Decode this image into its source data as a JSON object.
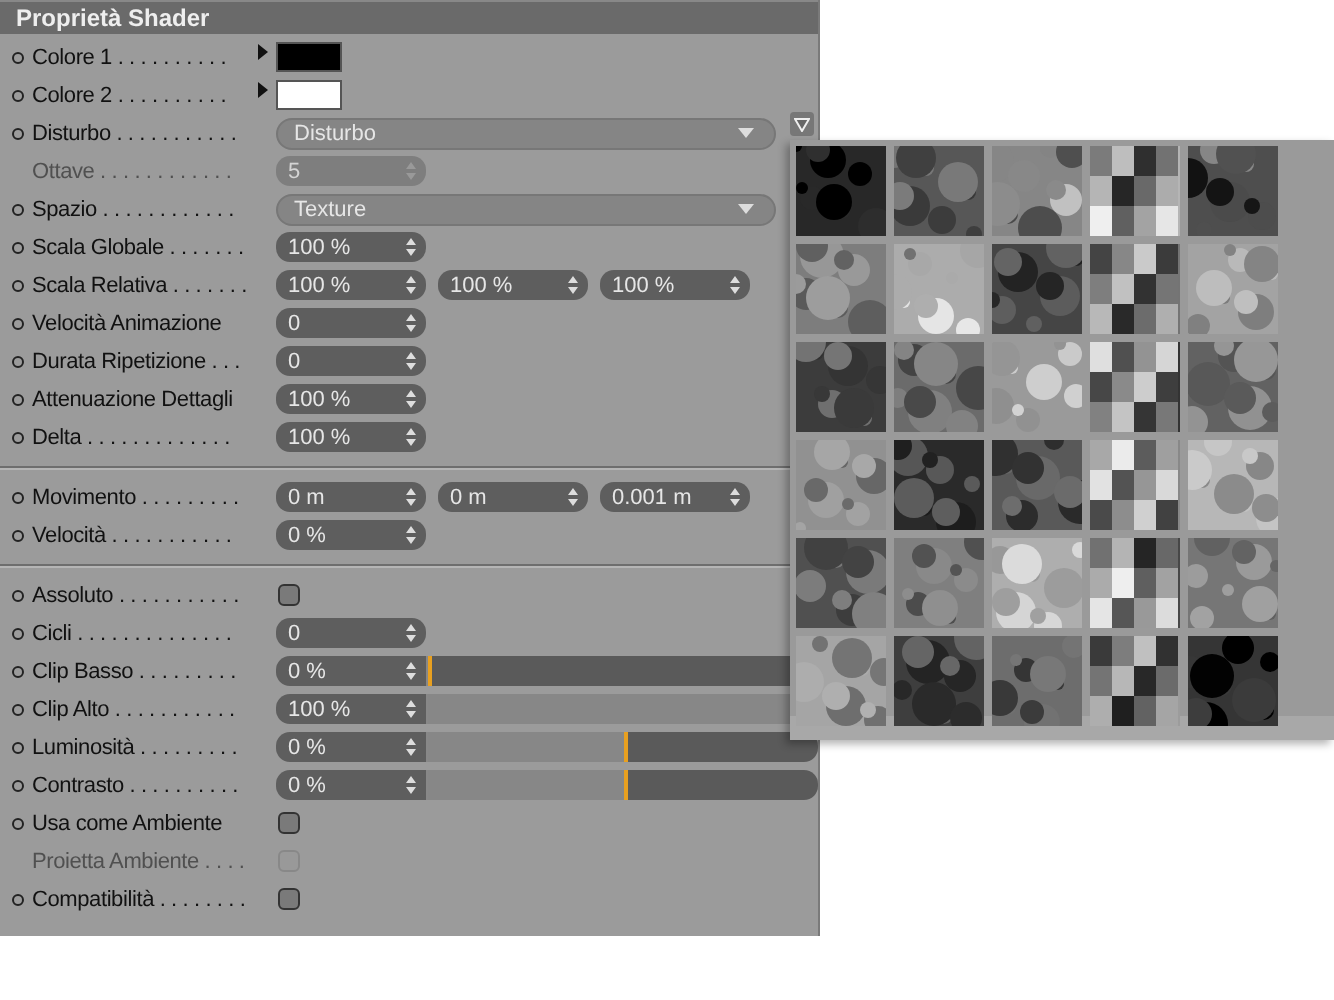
{
  "panel": {
    "title": "Proprietà Shader",
    "groups": [
      {
        "rows": [
          {
            "kind": "color",
            "label": "Colore 1 . . . . . . . . . .",
            "disabled": false,
            "color": "#000000"
          },
          {
            "kind": "color",
            "label": "Colore 2 . . . . . . . . . .",
            "disabled": false,
            "color": "#ffffff"
          },
          {
            "kind": "dropdown",
            "label": "Disturbo . . . . . . . . . . .",
            "disabled": false,
            "value": "Disturbo"
          },
          {
            "kind": "number",
            "label": "Ottave . . . . . . . . . . . .",
            "disabled": true,
            "value": "5"
          },
          {
            "kind": "dropdown",
            "label": "Spazio . . . . . . . . . . . .",
            "disabled": false,
            "value": "Texture"
          },
          {
            "kind": "number",
            "label": "Scala Globale . . . . . . .",
            "disabled": false,
            "value": "100 %"
          },
          {
            "kind": "triple",
            "label": "Scala Relativa . . . . . . .",
            "disabled": false,
            "values": [
              "100 %",
              "100 %",
              "100 %"
            ]
          },
          {
            "kind": "number",
            "label": "Velocità Animazione",
            "disabled": false,
            "value": "0"
          },
          {
            "kind": "number",
            "label": "Durata Ripetizione . . .",
            "disabled": false,
            "value": "0"
          },
          {
            "kind": "number",
            "label": "Attenuazione Dettagli",
            "disabled": false,
            "value": "100 %"
          },
          {
            "kind": "number",
            "label": "Delta . . . . . . . . . . . . .",
            "disabled": false,
            "value": "100 %"
          }
        ]
      },
      {
        "rows": [
          {
            "kind": "triple",
            "label": "Movimento . . . . . . . . .",
            "disabled": false,
            "values": [
              "0 m",
              "0 m",
              "0.001 m"
            ]
          },
          {
            "kind": "number",
            "label": "Velocità . . . . . . . . . . .",
            "disabled": false,
            "value": "0 %"
          }
        ]
      },
      {
        "rows": [
          {
            "kind": "checkbox",
            "label": "Assoluto . . . . . . . . . . .",
            "disabled": false,
            "checked": false
          },
          {
            "kind": "number",
            "label": "Cicli . . . . . . . . . . . . . .",
            "disabled": false,
            "value": "0"
          },
          {
            "kind": "slider",
            "label": "Clip Basso . . . . . . . . .",
            "disabled": false,
            "value": "0 %",
            "level": 0
          },
          {
            "kind": "slider",
            "label": "Clip Alto . . . . . . . . . . .",
            "disabled": false,
            "value": "100 %",
            "level": 1
          },
          {
            "kind": "slider",
            "label": "Luminosità . . . . . . . . .",
            "disabled": false,
            "value": "0 %",
            "level": 0.5
          },
          {
            "kind": "slider",
            "label": "Contrasto . . . . . . . . . .",
            "disabled": false,
            "value": "0 %",
            "level": 0.5
          },
          {
            "kind": "checkbox",
            "label": "Usa come Ambiente",
            "disabled": false,
            "checked": false
          },
          {
            "kind": "checkbox",
            "label": "Proietta Ambiente . . . .",
            "disabled": true,
            "checked": false
          },
          {
            "kind": "checkbox",
            "label": "Compatibilità . . . . . . . .",
            "disabled": false,
            "checked": false
          }
        ]
      }
    ]
  }
}
